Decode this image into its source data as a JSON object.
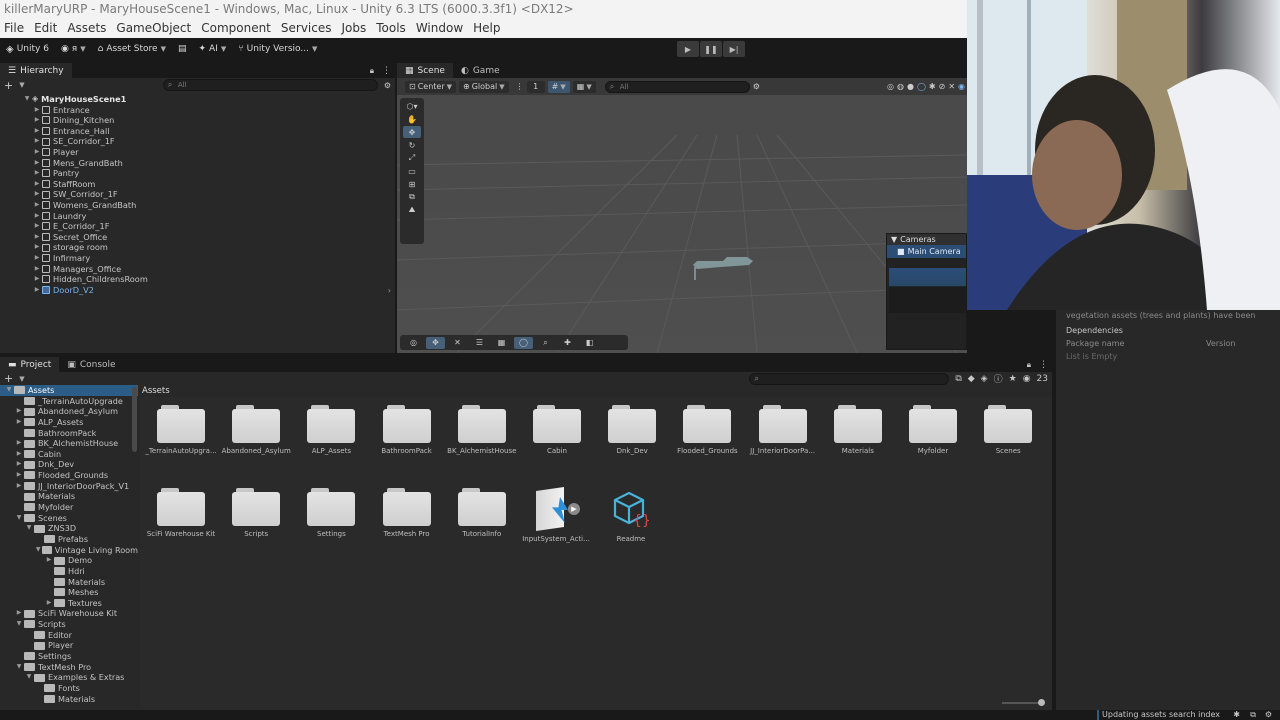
{
  "window": {
    "title": "killerMaryURP - MaryHouseScene1 - Windows, Mac, Linux - Unity 6.3 LTS (6000.3.3f1) <DX12>"
  },
  "menu": [
    "File",
    "Edit",
    "Assets",
    "GameObject",
    "Component",
    "Services",
    "Jobs",
    "Tools",
    "Window",
    "Help"
  ],
  "toolbar": {
    "unity": "Unity 6",
    "account": "я",
    "asset_store": "Asset Store",
    "ai": "AI",
    "version_control": "Unity Versio..."
  },
  "hierarchy": {
    "tab": "Hierarchy",
    "search_placeholder": "All",
    "scene": "MaryHouseScene1",
    "items": [
      "Entrance",
      "Dining_Kitchen",
      "Entrance_Hall",
      "SE_Corridor_1F",
      "Player",
      "Mens_GrandBath",
      "Pantry",
      "StaffRoom",
      "SW_Corridor_1F",
      "Womens_GrandBath",
      "Laundry",
      "E_Corridor_1F",
      "Secret_Office",
      "storage room",
      "Infirmary",
      "Managers_Office",
      "Hidden_ChildrensRoom"
    ],
    "prefab_item": "DoorD_V2"
  },
  "scene": {
    "tab_scene": "Scene",
    "tab_game": "Game",
    "pivot": "Center",
    "space": "Global",
    "snap": "1",
    "search_placeholder": "All",
    "camera_overlay": {
      "title": "Cameras",
      "selected": "Main Camera"
    }
  },
  "project": {
    "tab_project": "Project",
    "tab_console": "Console",
    "breadcrumb": "Assets",
    "count": "23",
    "tree": [
      {
        "label": "Assets",
        "depth": 0,
        "open": true,
        "sel": true
      },
      {
        "label": "_TerrainAutoUpgrade",
        "depth": 1
      },
      {
        "label": "Abandoned_Asylum",
        "depth": 1,
        "arrow": true
      },
      {
        "label": "ALP_Assets",
        "depth": 1,
        "arrow": true
      },
      {
        "label": "BathroomPack",
        "depth": 1
      },
      {
        "label": "BK_AlchemistHouse",
        "depth": 1,
        "arrow": true
      },
      {
        "label": "Cabin",
        "depth": 1,
        "arrow": true
      },
      {
        "label": "Dnk_Dev",
        "depth": 1,
        "arrow": true
      },
      {
        "label": "Flooded_Grounds",
        "depth": 1,
        "arrow": true
      },
      {
        "label": "JJ_InteriorDoorPack_V1",
        "depth": 1,
        "arrow": true
      },
      {
        "label": "Materials",
        "depth": 1
      },
      {
        "label": "Myfolder",
        "depth": 1
      },
      {
        "label": "Scenes",
        "depth": 1,
        "open": true
      },
      {
        "label": "ZNS3D",
        "depth": 2,
        "open": true
      },
      {
        "label": "Prefabs",
        "depth": 3
      },
      {
        "label": "Vintage Living Room",
        "depth": 3,
        "open": true
      },
      {
        "label": "Demo",
        "depth": 4,
        "arrow": true
      },
      {
        "label": "Hdri",
        "depth": 4
      },
      {
        "label": "Materials",
        "depth": 4
      },
      {
        "label": "Meshes",
        "depth": 4
      },
      {
        "label": "Textures",
        "depth": 4,
        "arrow": true
      },
      {
        "label": "SciFi Warehouse Kit",
        "depth": 1,
        "arrow": true
      },
      {
        "label": "Scripts",
        "depth": 1,
        "open": true
      },
      {
        "label": "Editor",
        "depth": 2
      },
      {
        "label": "Player",
        "depth": 2
      },
      {
        "label": "Settings",
        "depth": 1
      },
      {
        "label": "TextMesh Pro",
        "depth": 1,
        "open": true
      },
      {
        "label": "Examples & Extras",
        "depth": 2,
        "open": true
      },
      {
        "label": "Fonts",
        "depth": 3
      },
      {
        "label": "Materials",
        "depth": 3
      }
    ],
    "assets_row1": [
      "_TerrainAutoUpgra...",
      "Abandoned_Asylum",
      "ALP_Assets",
      "BathroomPack",
      "BK_AlchemistHouse",
      "Cabin",
      "Dnk_Dev",
      "Flooded_Grounds",
      "JJ_InteriorDoorPa...",
      "Materials",
      "Myfolder",
      "Scenes"
    ],
    "assets_row2": [
      "SciFi Warehouse Kit",
      "Scripts",
      "Settings",
      "TextMesh Pro",
      "TutorialInfo"
    ],
    "input_asset": "InputSystem_Acti...",
    "readme_asset": "Readme"
  },
  "inspector": {
    "text": "vegetation assets (trees and plants) have been",
    "dependencies": "Dependencies",
    "col_package": "Package name",
    "col_version": "Version",
    "empty": "List is Empty"
  },
  "status": {
    "text": "Updating assets search index"
  },
  "colors": {
    "selection": "#2c5d87",
    "prefab": "#7ab4ec",
    "accent": "#46607a"
  }
}
